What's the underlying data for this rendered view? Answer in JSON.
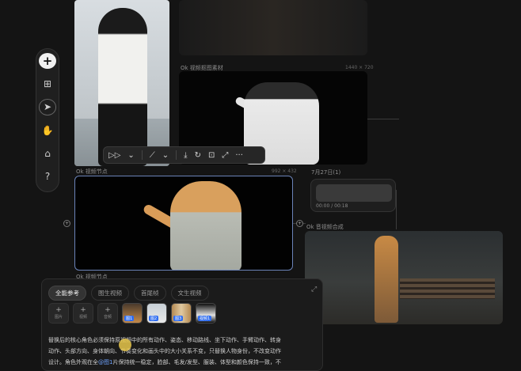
{
  "toolbar": {
    "items": [
      {
        "name": "add",
        "glyph": "+"
      },
      {
        "name": "grid",
        "glyph": "⊞"
      },
      {
        "name": "select",
        "glyph": "➤"
      },
      {
        "name": "hand",
        "glyph": "✋"
      },
      {
        "name": "camera",
        "glyph": "⌂"
      },
      {
        "name": "help",
        "glyph": "?"
      }
    ]
  },
  "nodes": {
    "mid": {
      "label": "Ok 视频抠图素材",
      "meta": "1440 × 720"
    },
    "cat": {
      "label": "Ok 视频节点",
      "meta": "992 × 432"
    },
    "cat_bottom": {
      "label": "Ok 视频节点"
    },
    "audio": {
      "label": "7月27日(1)",
      "time": "00:00 / 00:18"
    },
    "result": {
      "label": "Ok 音视频合成"
    }
  },
  "image_toolbar": {
    "items": [
      "▷▷",
      "⌄",
      "⟋",
      "⌄",
      "⤓",
      "↻",
      "⊡",
      "⤢",
      "···"
    ]
  },
  "panel": {
    "tabs": [
      "全能参考",
      "图生视频",
      "首尾帧",
      "文生视频"
    ],
    "add_buttons": [
      {
        "label": "图片"
      },
      {
        "label": "视频"
      },
      {
        "label": "音频"
      }
    ],
    "refs": [
      {
        "tag": "图1"
      },
      {
        "tag": "图2"
      },
      {
        "tag": "图3"
      },
      {
        "tag": "视频1"
      }
    ],
    "prompt_1": "替换后的核心角色必须保持原视频中的所有动作、姿态、移动路线、坐下动作、手臂动作、转身",
    "prompt_2": "动作、头部方向、身体朝向、节奏变化和画头中的大小关系不变，只替换人物身份，不改变动作",
    "prompt_3a": "设计。角色外观在全",
    "prompt_3b": "@图1",
    "prompt_3c": "片保持统一稳定，脸部、毛发/发型、服装、体型和颜色保持一致，不"
  },
  "colors": {
    "accent": "#2f6df0",
    "selection_border": "#6b83b8",
    "cursor": "#e6c64a"
  }
}
